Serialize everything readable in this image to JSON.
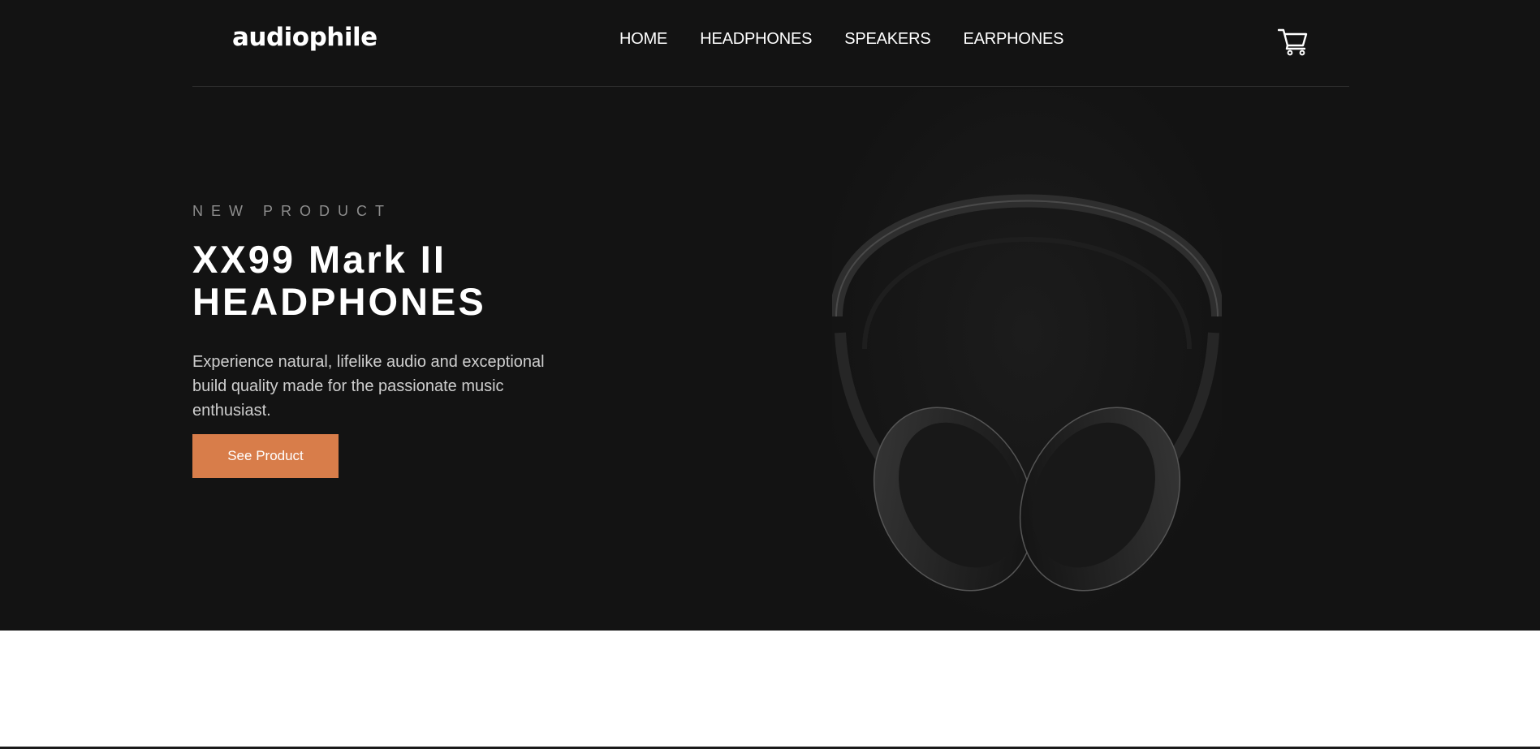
{
  "brand": {
    "logo": "audiophile"
  },
  "nav": {
    "items": [
      {
        "label": "HOME"
      },
      {
        "label": "HEADPHONES"
      },
      {
        "label": "SPEAKERS"
      },
      {
        "label": "EARPHONES"
      }
    ],
    "cart_icon": "cart-icon"
  },
  "hero": {
    "overline": "NEW PRODUCT",
    "title_line1": "XX99 Mark II",
    "title_line2": "HEADPHONES",
    "description": "Experience natural, lifelike audio and exceptional build quality made for the passionate music enthusiast.",
    "cta_label": "See Product",
    "image_icon": "headphones-image"
  },
  "colors": {
    "hero_bg": "#131313",
    "accent": "#d87d4a",
    "text": "#ffffff",
    "muted": "#8d8d8d"
  }
}
